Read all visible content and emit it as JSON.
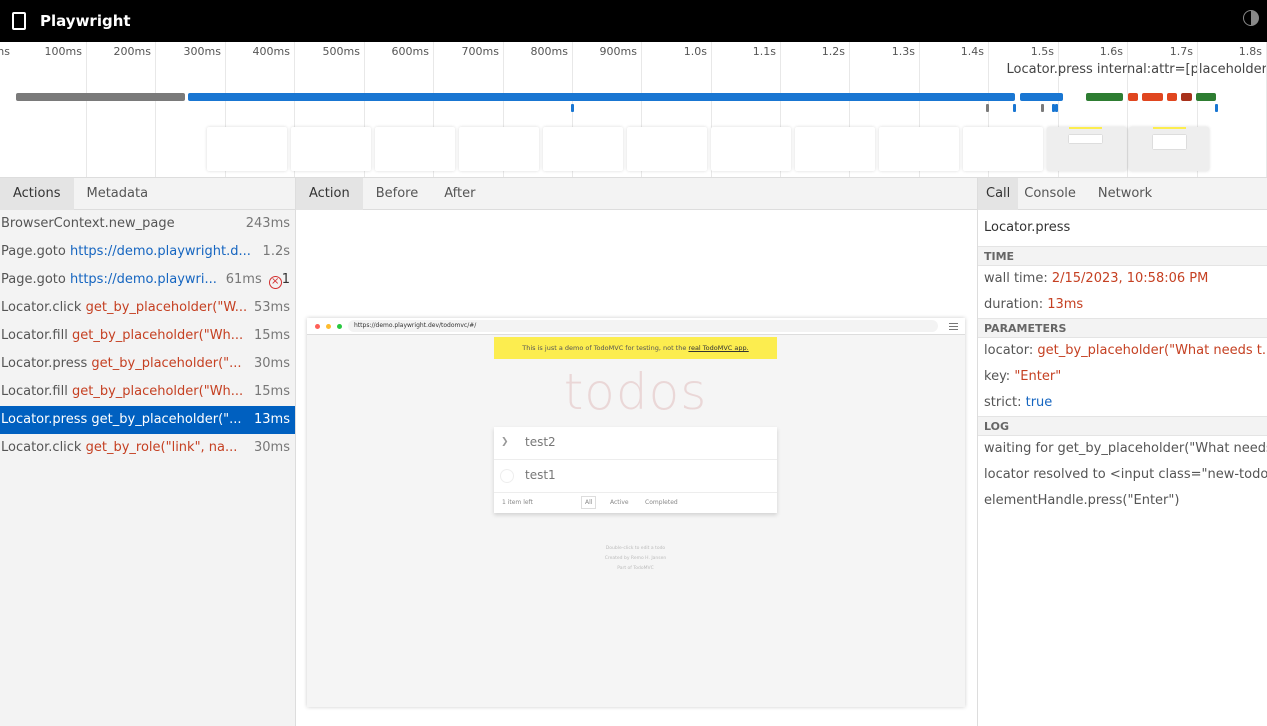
{
  "app": {
    "title": "Playwright"
  },
  "timeline": {
    "ticks": [
      "ms",
      "100ms",
      "200ms",
      "300ms",
      "400ms",
      "500ms",
      "600ms",
      "700ms",
      "800ms",
      "900ms",
      "1.0s",
      "1.1s",
      "1.2s",
      "1.3s",
      "1.4s",
      "1.5s",
      "1.6s",
      "1.7s",
      "1.8s"
    ],
    "hover_label": "Locator.press internal:attr=[placeholder",
    "colors": {
      "grey": "#7a7a7a",
      "blue": "#1976d2",
      "green": "#2e7d32",
      "red": "#e0461f",
      "dark_red": "#a8321b"
    }
  },
  "left": {
    "tabs": [
      "Actions",
      "Metadata"
    ],
    "actions": [
      {
        "api": "BrowserContext.new_page",
        "arg": "",
        "arg_kind": "sel",
        "duration": "243ms"
      },
      {
        "api": "Page.goto",
        "arg": "https://demo.playwright.d...",
        "arg_kind": "url",
        "duration": "1.2s"
      },
      {
        "api": "Page.goto",
        "arg": "https://demo.playwri...",
        "arg_kind": "url",
        "duration": "61ms",
        "errors": "1"
      },
      {
        "api": "Locator.click",
        "arg": "get_by_placeholder(\"W...",
        "arg_kind": "sel",
        "duration": "53ms"
      },
      {
        "api": "Locator.fill",
        "arg": "get_by_placeholder(\"Wh...",
        "arg_kind": "sel",
        "duration": "15ms"
      },
      {
        "api": "Locator.press",
        "arg": "get_by_placeholder(\"...",
        "arg_kind": "sel",
        "duration": "30ms"
      },
      {
        "api": "Locator.fill",
        "arg": "get_by_placeholder(\"Wh...",
        "arg_kind": "sel",
        "duration": "15ms"
      },
      {
        "api": "Locator.press",
        "arg": "get_by_placeholder(\"...",
        "arg_kind": "sel",
        "duration": "13ms",
        "selected": true
      },
      {
        "api": "Locator.click",
        "arg": "get_by_role(\"link\", na...",
        "arg_kind": "sel",
        "duration": "30ms"
      }
    ]
  },
  "center": {
    "tabs": [
      "Action",
      "Before",
      "After"
    ],
    "snapshot": {
      "url": "https://demo.playwright.dev/todomvc/#/",
      "banner_text": "This is just a demo of TodoMVC for testing, not the ",
      "banner_link": "real TodoMVC app.",
      "heading": "todos",
      "items": [
        "test2",
        "test1"
      ],
      "items_left": "1 item left",
      "filters": [
        "All",
        "Active",
        "Completed"
      ],
      "info_lines": [
        "Double-click to edit a todo",
        "Created by Remo H. Jansen",
        "Part of TodoMVC"
      ]
    }
  },
  "right": {
    "tabs": [
      "Call",
      "Console",
      "Network"
    ],
    "call_title": "Locator.press",
    "time_header": "TIME",
    "wall_time_label": "wall time: ",
    "wall_time": "2/15/2023, 10:58:06 PM",
    "duration_label": "duration: ",
    "duration": "13ms",
    "params_header": "PARAMETERS",
    "params": [
      {
        "key": "locator: ",
        "value": "get_by_placeholder(\"What needs t...",
        "kind": "str"
      },
      {
        "key": "key: ",
        "value": "\"Enter\"",
        "kind": "str"
      },
      {
        "key": "strict: ",
        "value": "true",
        "kind": "bool"
      }
    ],
    "log_header": "LOG",
    "log": [
      "waiting for get_by_placeholder(\"What needs",
      "locator resolved to <input class=\"new-todo",
      "elementHandle.press(\"Enter\")"
    ]
  }
}
